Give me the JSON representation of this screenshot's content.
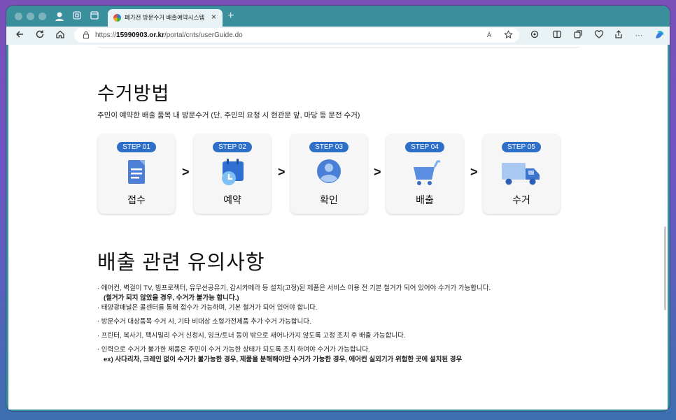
{
  "browser": {
    "tab_title": "폐가전 방문수거 배출예약시스템",
    "tab_close": "×",
    "new_tab": "+",
    "url_prefix": "https://",
    "url_host": "15990903.or.kr",
    "url_path": "/portal/cnts/userGuide.do",
    "read_aloud": "Á",
    "more": "···"
  },
  "page": {
    "title": "수거방법",
    "subtitle": "주민이 예약한 배출 품목 내 방문수거 (단, 주민의 요청 시 현관문 앞, 마당 등 문전 수거)",
    "steps": [
      {
        "badge": "STEP 01",
        "label": "접수",
        "icon": "document-icon"
      },
      {
        "badge": "STEP 02",
        "label": "예약",
        "icon": "calendar-clock-icon"
      },
      {
        "badge": "STEP 03",
        "label": "확인",
        "icon": "person-icon"
      },
      {
        "badge": "STEP 04",
        "label": "배출",
        "icon": "cart-icon"
      },
      {
        "badge": "STEP 05",
        "label": "수거",
        "icon": "truck-icon"
      }
    ],
    "arrow": ">",
    "notes_title": "배출 관련 유의사항",
    "notes": {
      "n1": "· 에어컨, 벽걸이 TV, 빔프로젝터, 유무선공유기, 감시카메라 등 설치(고정)된 제품은 서비스 이용 전 기본 철거가 되어 있어야 수거가 가능합니다.",
      "n1b": "(철거가 되지 않았을 경우, 수거가 불가능 합니다.)",
      "n2": "· 태양광패널은 콜센터를 통해 접수가 가능하며, 기본 철거가 되어 있어야 합니다.",
      "n3": "· 방문수거 대상품목 수거 시, 기타 비대상 소형가전제품 추가 수거 가능합니다.",
      "n4": "· 프린터, 복사기, 팩시밀리 수거 신청시, 잉크/토너 등이 밖으로 새어나가지 않도록 고정 조치 후 배출 가능합니다.",
      "n5": "· 인력으로 수거가 불가한 제품은 주민이 수거 가능한 상태가 되도록 조치 하여야 수거가 가능합니다.",
      "n5b": "ex) 사다리차, 크레인 없이 수거가 불가능한 경우, 제품을 분해해야만 수거가 가능한 경우, 에어컨 실외기가 위험한 곳에 설치된 경우"
    }
  }
}
